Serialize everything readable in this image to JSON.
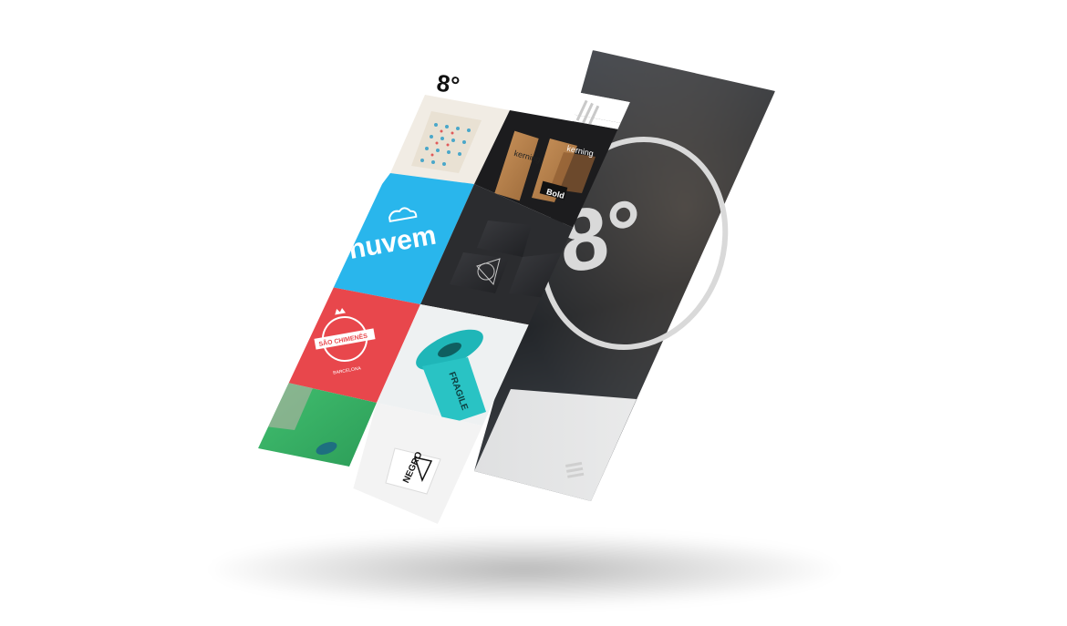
{
  "brand": {
    "logo_text": "8°",
    "back_logo_text": "8°"
  },
  "tiles": [
    {
      "name": "pattern-bags",
      "color": "#f1ece4"
    },
    {
      "name": "kerning-packaging",
      "color": "#1c1c1e",
      "text_a": "kerning",
      "text_b": "kerning",
      "text_c": "Bold"
    },
    {
      "name": "nuvem-logo",
      "color": "#29b6ec",
      "text": "nuvem"
    },
    {
      "name": "dark-boxes",
      "color": "#2b2c2f"
    },
    {
      "name": "red-emblem",
      "color": "#e8474c",
      "text": "SÃO CHIMENÊS",
      "sub": "BARCELONA"
    },
    {
      "name": "teal-tape",
      "color": "#eef1f2",
      "text": "FRAGILE"
    },
    {
      "name": "green-card",
      "color": "#3cb36b"
    },
    {
      "name": "negro-stationery",
      "color": "#f3f3f3",
      "text": "NEGRO"
    }
  ],
  "colors": {
    "menu_icon": "#c9c9c9",
    "header_bg": "#ffffff",
    "back_screen": "#2e3237"
  },
  "icons": {
    "front_menu": "hamburger-menu-icon",
    "back_menu": "hamburger-menu-icon"
  }
}
